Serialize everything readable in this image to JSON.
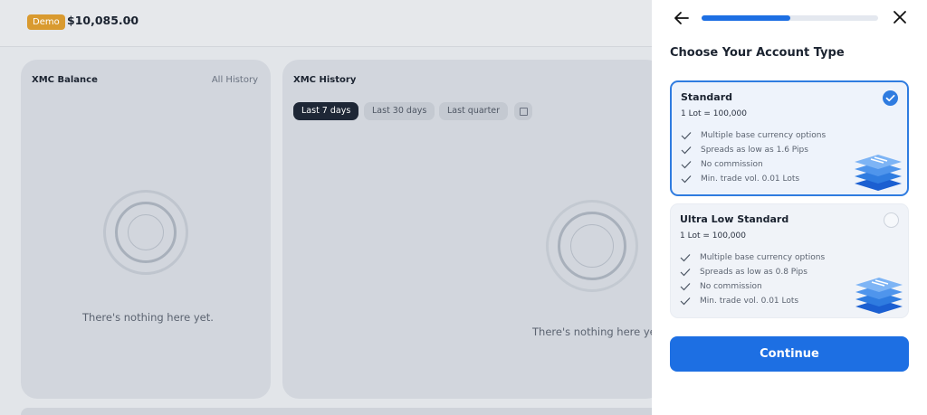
{
  "header": {
    "badge": "Demo",
    "balance": "$10,085.00",
    "balance_chevron": "⌄"
  },
  "balance_card": {
    "title": "XMC Balance",
    "link": "All History",
    "empty_text": "There's nothing here yet."
  },
  "history_card": {
    "title": "XMC History",
    "filters": [
      "Last 7 days",
      "Last 30 days",
      "Last quarter"
    ],
    "active_filter": "Last 7 days",
    "calendar_icon": "calendar-icon",
    "empty_text": "There's nothing here yet."
  },
  "panel": {
    "back_icon": "arrow-left-icon",
    "close_icon": "close-icon",
    "progress_fraction": 0.5,
    "title": "Choose Your Account Type",
    "options": [
      {
        "name": "Standard",
        "lot": "1 Lot = 100,000",
        "selected": true,
        "features": [
          "Multiple base currency options",
          "Spreads as low as 1.6 Pips",
          "No commission",
          "Min. trade vol. 0.01 Lots"
        ]
      },
      {
        "name": "Ultra Low Standard",
        "lot": "1 Lot = 100,000",
        "selected": false,
        "features": [
          "Multiple base currency options",
          "Spreads as low as 0.8 Pips",
          "No commission",
          "Min. trade vol. 0.01 Lots"
        ]
      }
    ],
    "continue_label": "Continue"
  },
  "colors": {
    "accent": "#1d6fe3",
    "badge": "#d99a2f",
    "active_filter": "#1e2736"
  }
}
